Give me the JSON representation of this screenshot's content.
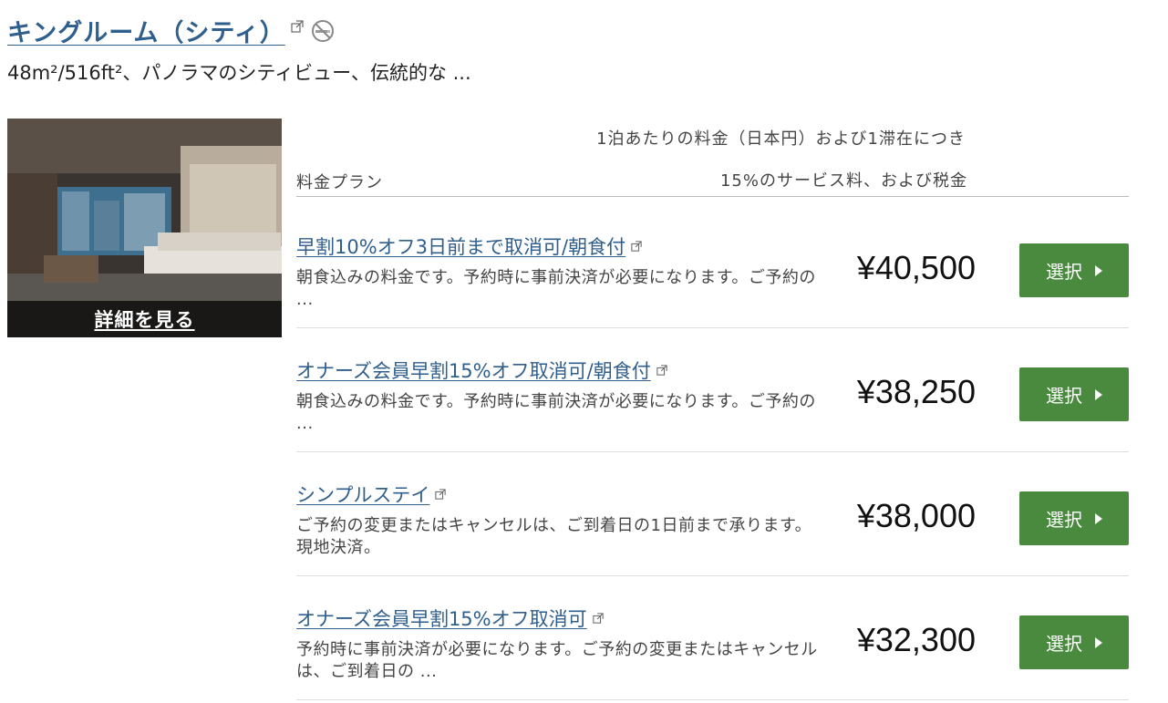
{
  "room": {
    "title": "キングルーム（シティ）",
    "description": "48m²/516ft²、パノラマのシティビュー、伝統的な ...",
    "details_link": "詳細を見る"
  },
  "table_header": {
    "rate_label": "1泊あたりの料金（日本円）および1滞在につき",
    "plan_label": "料金プラン",
    "service_label": "15%のサービス料、および税金"
  },
  "plans": [
    {
      "name": "早割10%オフ3日前まで取消可/朝食付",
      "description": "朝食込みの料金です。予約時に事前決済が必要になります。ご予約の ...",
      "price": "¥40,500",
      "button": "選択"
    },
    {
      "name": "オナーズ会員早割15%オフ取消可/朝食付",
      "description": "朝食込みの料金です。予約時に事前決済が必要になります。ご予約の ...",
      "price": "¥38,250",
      "button": "選択"
    },
    {
      "name": "シンプルステイ",
      "description": "ご予約の変更またはキャンセルは、ご到着日の1日前まで承ります。現地決済。",
      "price": "¥38,000",
      "button": "選択"
    },
    {
      "name": "オナーズ会員早割15%オフ取消可",
      "description": "予約時に事前決済が必要になります。ご予約の変更またはキャンセルは、ご到着日の ...",
      "price": "¥32,300",
      "button": "選択"
    }
  ],
  "colors": {
    "link": "#2f5f8c",
    "button": "#4a8a3f"
  },
  "icons": {
    "external": "external-link-icon",
    "nosmoking": "no-smoking-icon",
    "select_arrow": "caret-right-icon"
  }
}
